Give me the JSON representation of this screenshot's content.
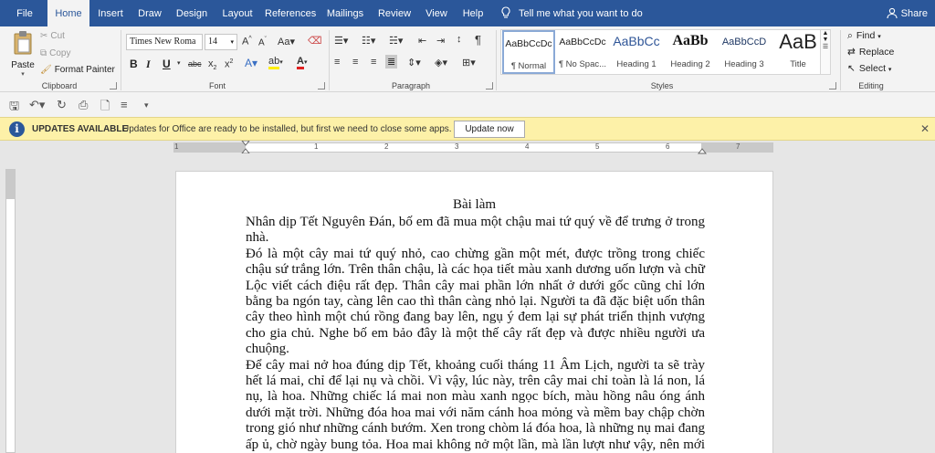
{
  "tabs": [
    {
      "label": "File",
      "active": false
    },
    {
      "label": "Home",
      "active": true
    },
    {
      "label": "Insert",
      "active": false
    },
    {
      "label": "Draw",
      "active": false
    },
    {
      "label": "Design",
      "active": false
    },
    {
      "label": "Layout",
      "active": false
    },
    {
      "label": "References",
      "active": false
    },
    {
      "label": "Mailings",
      "active": false
    },
    {
      "label": "Review",
      "active": false
    },
    {
      "label": "View",
      "active": false
    },
    {
      "label": "Help",
      "active": false
    }
  ],
  "tell_me": "Tell me what you want to do",
  "share": "Share",
  "clipboard": {
    "paste": "Paste",
    "cut": "Cut",
    "copy": "Copy",
    "format_painter": "Format Painter",
    "label": "Clipboard"
  },
  "font": {
    "name": "Times New Roma",
    "size": "14",
    "label": "Font"
  },
  "paragraph": {
    "label": "Paragraph"
  },
  "styles": {
    "label": "Styles",
    "items": [
      {
        "sample": "AaBbCcDc",
        "name": "¶ Normal"
      },
      {
        "sample": "AaBbCcDc",
        "name": "¶ No Spac..."
      },
      {
        "sample": "AaBbCc",
        "name": "Heading 1"
      },
      {
        "sample": "AaBb",
        "name": "Heading 2"
      },
      {
        "sample": "AaBbCcD",
        "name": "Heading 3"
      },
      {
        "sample": "AaB",
        "name": "Title"
      }
    ]
  },
  "editing": {
    "find": "Find",
    "replace": "Replace",
    "select": "Select",
    "label": "Editing"
  },
  "update_bar": {
    "title": "UPDATES AVAILABLE",
    "message": "Updates for Office are ready to be installed, but first we need to close some apps.",
    "button": "Update now"
  },
  "ruler": {
    "numbers": [
      "1",
      "1",
      "2",
      "3",
      "4",
      "5",
      "6",
      "7"
    ]
  },
  "document": {
    "title": "Bài làm",
    "paragraphs": [
      "Nhân dịp Tết Nguyên Đán, bố em đã mua một chậu mai tứ quý về để trưng ở trong nhà.",
      "Đó là một cây mai tứ quý nhỏ, cao chừng gần một mét, được trồng trong chiếc chậu sứ trắng lớn. Trên thân chậu, là các họa tiết màu xanh dương uốn lượn và chữ Lộc viết cách điệu rất đẹp. Thân cây mai phần lớn nhất ở dưới gốc cũng chỉ lớn bằng ba ngón tay, càng lên cao thì thân càng nhỏ lại. Người ta đã đặc biệt uốn thân cây theo hình một chú rồng đang bay lên, ngụ ý đem lại sự phát triển thịnh vượng cho gia chủ. Nghe bố em bảo đây là một thế cây rất đẹp và được nhiều người ưa chuộng.",
      "Để cây mai nở hoa đúng dịp Tết, khoảng cuối tháng 11 Âm Lịch, người ta sẽ trày hết lá mai, chỉ để lại nụ và chồi. Vì vậy, lúc này, trên cây mai chỉ toàn là lá non, lá nụ, là hoa. Những chiếc lá mai non màu xanh ngọc bích, màu hồng nâu óng ánh dưới mặt trời. Những đóa hoa mai với năm cánh hoa mỏng và mềm bay chập chờn trong gió như những cánh bướm. Xen trong chòm lá đóa hoa, là những nụ mai đang ấp ủ, chờ ngày bung tỏa. Hoa mai không nở một lần, mà lần lượt như vậy, nên mới có thể đủ sức nở cả mùa xuân."
    ]
  },
  "colors": {
    "title_bar": "#2b579a",
    "ribbon_bg": "#f3f3f3",
    "update_bar": "#fdf1a8",
    "workspace": "#e6e6e6",
    "font_color_red": "#e02020",
    "highlight_yellow": "#ffee00"
  }
}
